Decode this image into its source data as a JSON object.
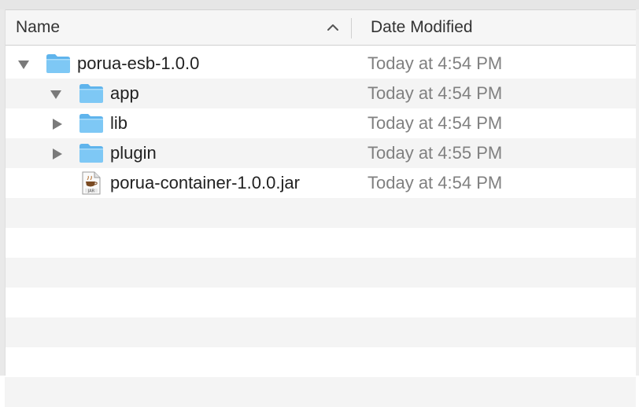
{
  "header": {
    "name_label": "Name",
    "date_label": "Date Modified"
  },
  "rows": [
    {
      "name": "porua-esb-1.0.0",
      "date": "Today at 4:54 PM",
      "kind": "folder",
      "disclosure": "expanded",
      "depth": 0
    },
    {
      "name": "app",
      "date": "Today at 4:54 PM",
      "kind": "folder",
      "disclosure": "expanded",
      "depth": 1
    },
    {
      "name": "lib",
      "date": "Today at 4:54 PM",
      "kind": "folder",
      "disclosure": "collapsed",
      "depth": 1
    },
    {
      "name": "plugin",
      "date": "Today at 4:55 PM",
      "kind": "folder",
      "disclosure": "collapsed",
      "depth": 1
    },
    {
      "name": "porua-container-1.0.0.jar",
      "date": "Today at 4:54 PM",
      "kind": "jar-file",
      "disclosure": "none",
      "depth": 1
    }
  ],
  "icons": {
    "sort": "chevron-up-icon",
    "expanded": "disclosure-triangle-down-icon",
    "collapsed": "disclosure-triangle-right-icon",
    "folder": "folder-icon",
    "jar": "jar-file-icon"
  },
  "colors": {
    "folder_fill": "#7ec8f5",
    "folder_tab": "#5fb4ec",
    "date_text": "#808080",
    "stripe": "#f4f4f4"
  }
}
